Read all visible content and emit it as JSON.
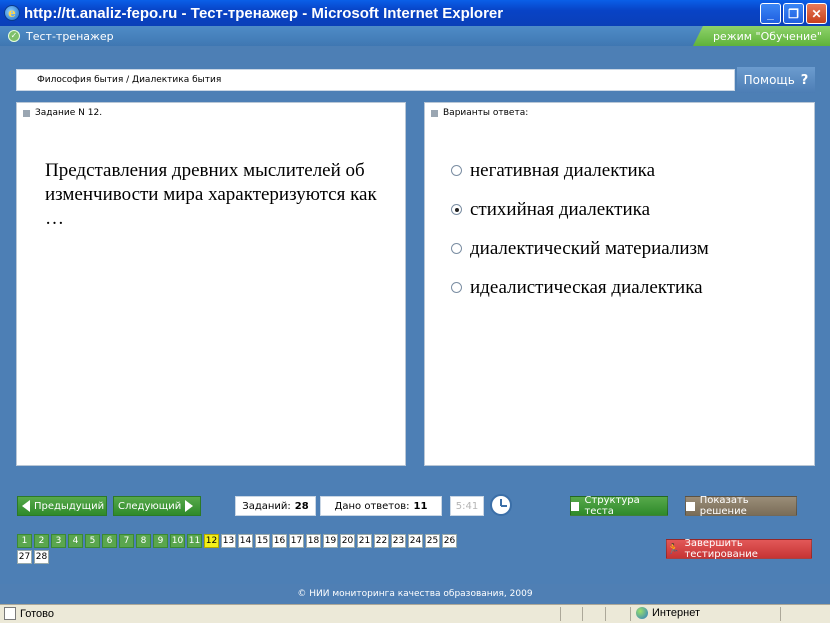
{
  "window": {
    "title": "http://tt.analiz-fepo.ru - Тест-тренажер - Microsoft Internet Explorer",
    "min_label": "_",
    "max_label": "❐",
    "close_label": "✕"
  },
  "app": {
    "name": "Тест-тренажер",
    "mode": "режим \"Обучение\""
  },
  "breadcrumb": "Философия бытия / Диалектика бытия",
  "help": {
    "label": "Помощь",
    "icon": "?"
  },
  "task_panel": {
    "header": "Задание N 12.",
    "question": "Представления древних мыслителей об изменчивости мира характеризуются как …"
  },
  "answers_panel": {
    "header": "Варианты ответа:",
    "options": [
      {
        "text": "негативная диалектика",
        "checked": false
      },
      {
        "text": "стихийная диалектика",
        "checked": true
      },
      {
        "text": "диалектический материализм",
        "checked": false
      },
      {
        "text": "идеалистическая диалектика",
        "checked": false
      }
    ]
  },
  "nav": {
    "prev_label": "Предыдущий",
    "next_label": "Следующий",
    "tasks_label": "Заданий:",
    "tasks_count": "28",
    "answers_label": "Дано ответов:",
    "answers_count": "11",
    "timer": "5:41",
    "structure_label": "Структура теста",
    "solution_label": "Показать решение",
    "finish_label": "Завершить тестирование"
  },
  "tasks": {
    "numbers": [
      "1",
      "2",
      "3",
      "4",
      "5",
      "6",
      "7",
      "8",
      "9",
      "10",
      "11",
      "12",
      "13",
      "14",
      "15",
      "16",
      "17",
      "18",
      "19",
      "20",
      "21",
      "22",
      "23",
      "24",
      "25",
      "26",
      "27",
      "28"
    ],
    "done_through": 11,
    "current": 12
  },
  "footer": "© НИИ мониторинга качества образования, 2009",
  "status": {
    "text": "Готово",
    "zone": "Интернет"
  },
  "colors": {
    "green": "#5aa64e",
    "current_yellow": "#f3f01a",
    "finish_red": "#c63434",
    "header_blue": "#4f7fb4"
  }
}
